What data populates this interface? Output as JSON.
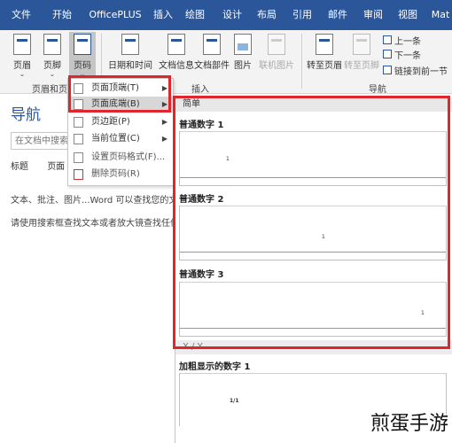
{
  "tabs": [
    "文件",
    "开始",
    "OfficePLUS",
    "插入",
    "绘图",
    "设计",
    "布局",
    "引用",
    "邮件",
    "审阅",
    "视图",
    "Mat"
  ],
  "ribbon": {
    "buttons": {
      "header": "页眉",
      "footer": "页脚",
      "page_number": "页码",
      "datetime": "日期和时间",
      "docinfo": "文档信息",
      "quickparts": "文档部件",
      "picture": "图片",
      "online_picture": "联机图片",
      "goto_header": "转至页眉",
      "goto_footer": "转至页脚"
    },
    "small_buttons": {
      "prev": "上一条",
      "next": "下一条",
      "link_prev": "链接到前一节"
    },
    "groups": {
      "header_footer": "页眉和页脚",
      "insert": "插入",
      "navigation": "导航"
    }
  },
  "nav": {
    "title": "导航",
    "search_placeholder": "在文档中搜索",
    "tabs": [
      "标题",
      "页面"
    ],
    "text1": "文本、批注、图片...Word 可以查找您的文档",
    "text2": "请使用搜索框查找文本或者放大镜查找任何"
  },
  "menu": {
    "items": [
      "页面顶端(T)",
      "页面底端(B)",
      "页边距(P)",
      "当前位置(C)",
      "设置页码格式(F)...",
      "删除页码(R)"
    ]
  },
  "gallery": {
    "section": "简单",
    "items": [
      "普通数字 1",
      "普通数字 2",
      "普通数字 3"
    ],
    "section2": "X / Y",
    "bold_item": "加粗显示的数字 1"
  },
  "watermark": "煎蛋手游",
  "colors": {
    "ribbon_blue": "#2b579a",
    "highlight_red": "#e0262c"
  }
}
